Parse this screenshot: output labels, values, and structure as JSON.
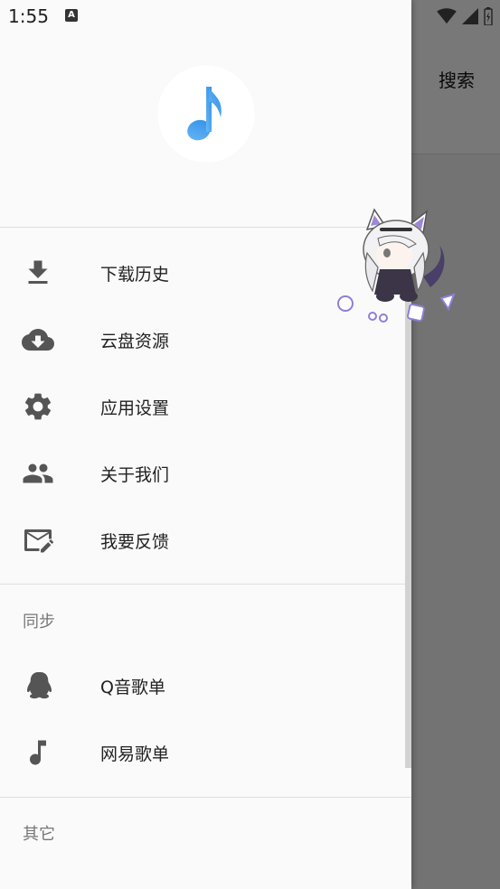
{
  "status_bar": {
    "time": "1:55",
    "notification_icon_letter": "A"
  },
  "background_app": {
    "search_label": "搜索"
  },
  "drawer": {
    "menu": [
      {
        "label": "下载历史",
        "icon": "download-icon"
      },
      {
        "label": "云盘资源",
        "icon": "cloud-download-icon"
      },
      {
        "label": "应用设置",
        "icon": "gear-icon"
      },
      {
        "label": "关于我们",
        "icon": "people-icon"
      },
      {
        "label": "我要反馈",
        "icon": "feedback-mail-icon"
      }
    ],
    "sync_section": {
      "title": "同步",
      "items": [
        {
          "label": "Q音歌单",
          "icon": "qq-penguin-icon"
        },
        {
          "label": "网易歌单",
          "icon": "music-note-icon"
        }
      ]
    },
    "other_section": {
      "title": "其它"
    }
  },
  "colors": {
    "logo_blue": "#3aa0f0",
    "icon_gray": "#555555"
  }
}
